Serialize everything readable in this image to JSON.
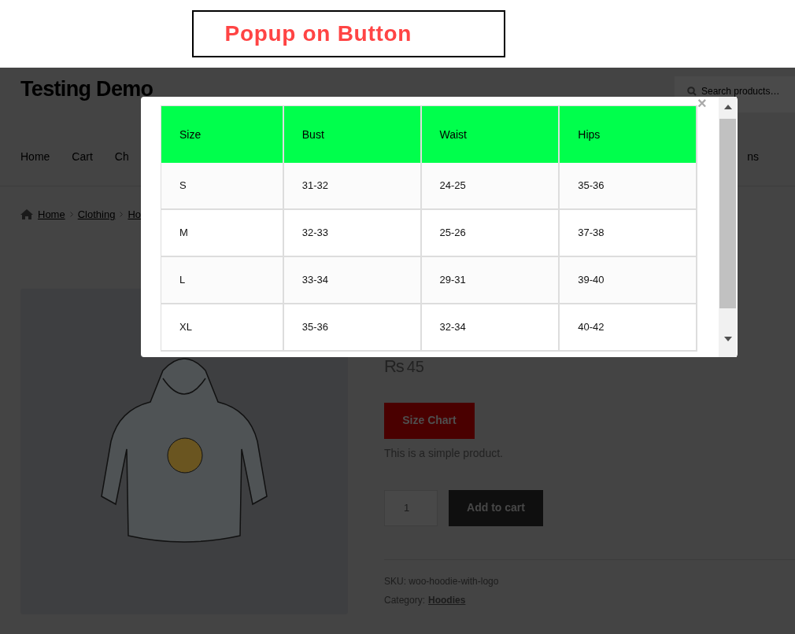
{
  "banner": {
    "title": "Popup on Button"
  },
  "header": {
    "site_title": "Testing Demo",
    "search": {
      "placeholder": "Search products…"
    },
    "nav": [
      "Home",
      "Cart",
      "Ch"
    ],
    "nav_right": "ns"
  },
  "breadcrumb": [
    "Home",
    "Clothing",
    "Ho"
  ],
  "product": {
    "currency": "Rs",
    "amount": "45",
    "size_chart_button": "Size Chart",
    "description": "This is a simple product.",
    "quantity": "1",
    "add_to_cart": "Add to cart",
    "sku": "SKU: woo-hoodie-with-logo",
    "category_label": "Category:",
    "category": "Hoodies"
  },
  "modal": {
    "close": "×",
    "columns": [
      "Size",
      "Bust",
      "Waist",
      "Hips"
    ],
    "rows": [
      [
        "S",
        "31-32",
        "24-25",
        "35-36"
      ],
      [
        "M",
        "32-33",
        "25-26",
        "37-38"
      ],
      [
        "L",
        "33-34",
        "29-31",
        "39-40"
      ],
      [
        "XL",
        "35-36",
        "32-34",
        "40-42"
      ]
    ]
  }
}
